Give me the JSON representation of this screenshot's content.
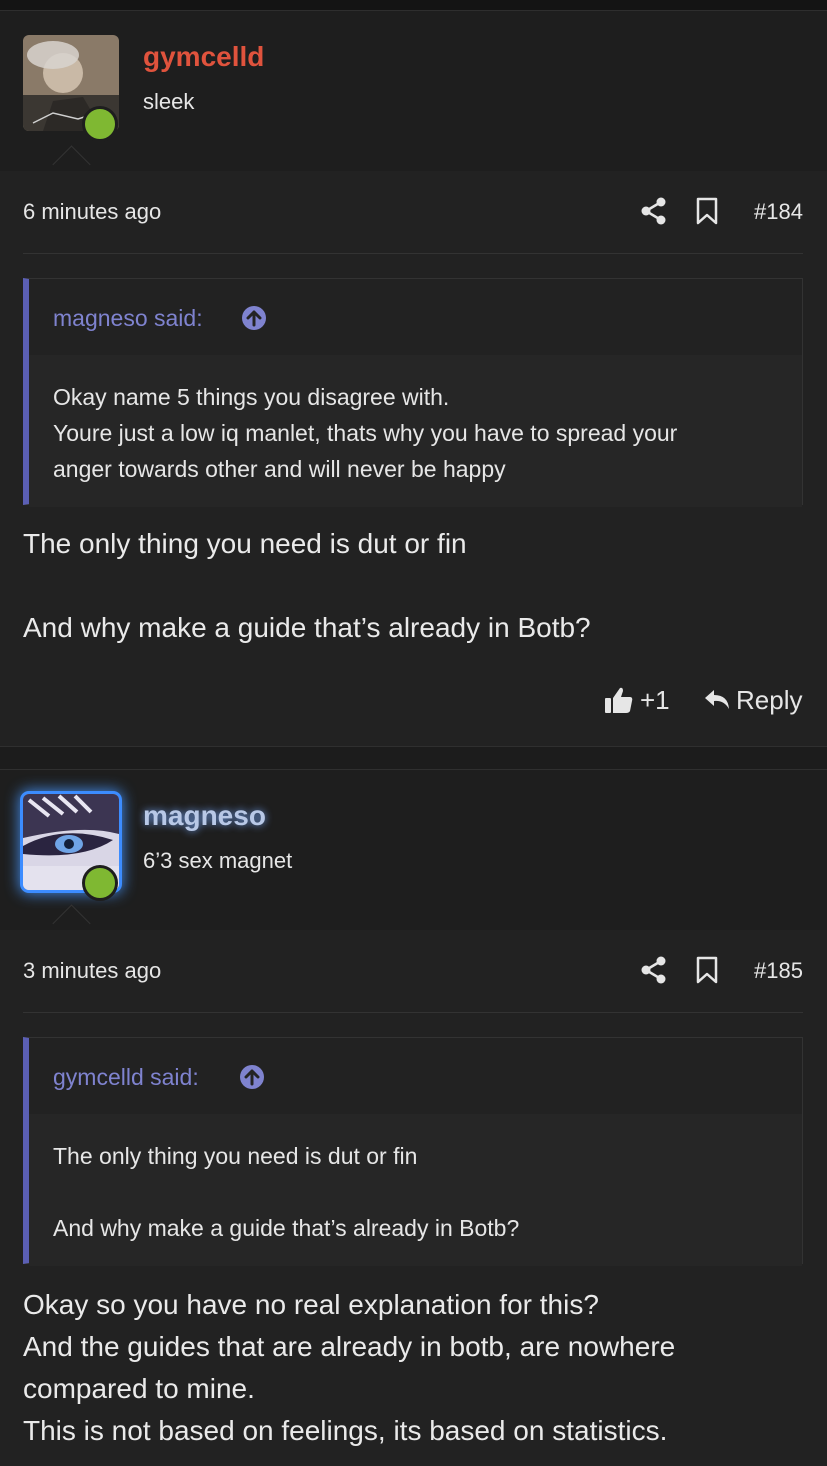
{
  "colors": {
    "accent_quote": "#5b5fb4",
    "username_red": "#e0533d",
    "online": "#7fb832"
  },
  "icons": [
    "share-icon",
    "bookmark-icon",
    "arrow-up-circle-icon",
    "thumbs-up-icon",
    "reply-icon"
  ],
  "posts": [
    {
      "author": "gymcelld",
      "user_title": "sleek",
      "time": "6 minutes ago",
      "post_number": "#184",
      "quote": {
        "said": "magneso said:",
        "lines": [
          "Okay name 5 things you disagree with.",
          "Youre just a low iq manlet, thats why you have to spread your",
          "anger towards other and will never be happy"
        ]
      },
      "message": [
        "The only thing you need is dut or fin",
        "And why make a guide that’s already in Botb?"
      ],
      "reactions": "+1",
      "reply_label": "Reply"
    },
    {
      "author": "magneso",
      "user_title": "6’3 sex magnet",
      "time": "3 minutes ago",
      "post_number": "#185",
      "quote": {
        "said": "gymcelld said:",
        "lines": [
          "The only thing you need is dut or fin",
          "And why make a guide that’s already in Botb?"
        ]
      },
      "message": [
        "Okay so you have no real explanation for this?",
        "And the guides that are already in botb, are nowhere",
        "compared to mine.",
        "This is not based on feelings, its based on statistics."
      ]
    }
  ]
}
